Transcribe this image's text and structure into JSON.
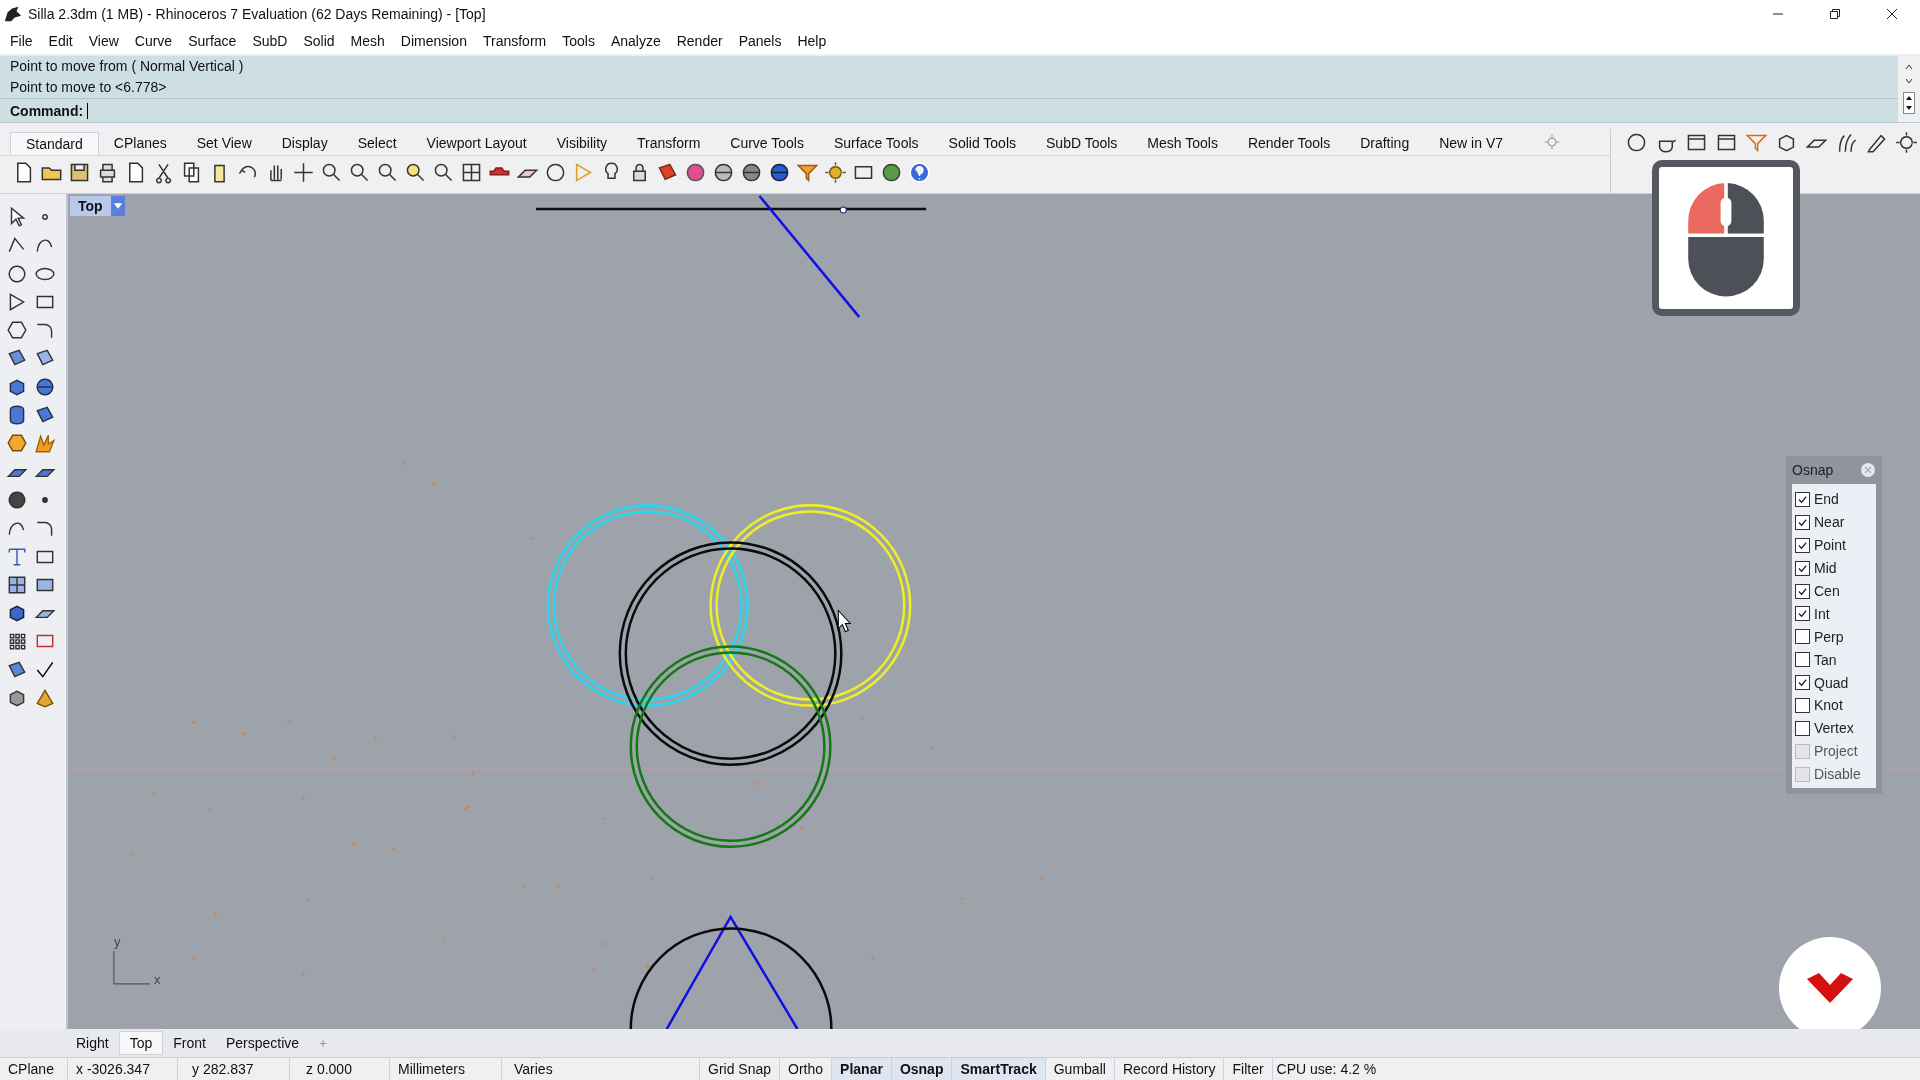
{
  "window": {
    "title": "Silla 2.3dm (1 MB) - Rhinoceros 7 Evaluation (62 Days Remaining) - [Top]"
  },
  "menu": [
    "File",
    "Edit",
    "View",
    "Curve",
    "Surface",
    "SubD",
    "Solid",
    "Mesh",
    "Dimension",
    "Transform",
    "Tools",
    "Analyze",
    "Render",
    "Panels",
    "Help"
  ],
  "command_history": [
    "Point to move from ( Normal  Vertical )",
    "Point to move to <6.778>"
  ],
  "command_prompt": {
    "label": "Command:"
  },
  "toolbar_tabs": [
    {
      "label": "Standard",
      "selected": true
    },
    {
      "label": "CPlanes",
      "selected": false
    },
    {
      "label": "Set View",
      "selected": false
    },
    {
      "label": "Display",
      "selected": false
    },
    {
      "label": "Select",
      "selected": false
    },
    {
      "label": "Viewport Layout",
      "selected": false
    },
    {
      "label": "Visibility",
      "selected": false
    },
    {
      "label": "Transform",
      "selected": false
    },
    {
      "label": "Curve Tools",
      "selected": false
    },
    {
      "label": "Surface Tools",
      "selected": false
    },
    {
      "label": "Solid Tools",
      "selected": false
    },
    {
      "label": "SubD Tools",
      "selected": false
    },
    {
      "label": "Mesh Tools",
      "selected": false
    },
    {
      "label": "Render Tools",
      "selected": false
    },
    {
      "label": "Drafting",
      "selected": false
    },
    {
      "label": "New in V7",
      "selected": false
    }
  ],
  "viewport": {
    "title": "Top",
    "axis_y": "y",
    "axis_x": "x"
  },
  "osnap": {
    "title": "Osnap",
    "options": [
      {
        "label": "End",
        "checked": true,
        "disabled": false
      },
      {
        "label": "Near",
        "checked": true,
        "disabled": false
      },
      {
        "label": "Point",
        "checked": true,
        "disabled": false
      },
      {
        "label": "Mid",
        "checked": true,
        "disabled": false
      },
      {
        "label": "Cen",
        "checked": true,
        "disabled": false
      },
      {
        "label": "Int",
        "checked": true,
        "disabled": false
      },
      {
        "label": "Perp",
        "checked": false,
        "disabled": false
      },
      {
        "label": "Tan",
        "checked": false,
        "disabled": false
      },
      {
        "label": "Quad",
        "checked": true,
        "disabled": false
      },
      {
        "label": "Knot",
        "checked": false,
        "disabled": false
      },
      {
        "label": "Vertex",
        "checked": false,
        "disabled": false
      },
      {
        "label": "Project",
        "checked": false,
        "disabled": true
      },
      {
        "label": "Disable",
        "checked": false,
        "disabled": true
      }
    ]
  },
  "viewport_tabs": [
    {
      "label": "Right",
      "selected": false
    },
    {
      "label": "Top",
      "selected": true
    },
    {
      "label": "Front",
      "selected": false
    },
    {
      "label": "Perspective",
      "selected": false
    }
  ],
  "viewport_tab_add": "+",
  "status_bar": {
    "cplane": "CPlane",
    "x": "x -3026.347",
    "y": "y 282.837",
    "z": "z 0.000",
    "units": "Millimeters",
    "layer": "Varies",
    "toggles": [
      {
        "label": "Grid Snap",
        "on": false
      },
      {
        "label": "Ortho",
        "on": false
      },
      {
        "label": "Planar",
        "on": true
      },
      {
        "label": "Osnap",
        "on": true
      },
      {
        "label": "SmartTrack",
        "on": true
      },
      {
        "label": "Gumball",
        "on": false
      },
      {
        "label": "Record History",
        "on": false
      },
      {
        "label": "Filter",
        "on": false
      }
    ],
    "cpu": "CPU use: 4.2 %"
  }
}
